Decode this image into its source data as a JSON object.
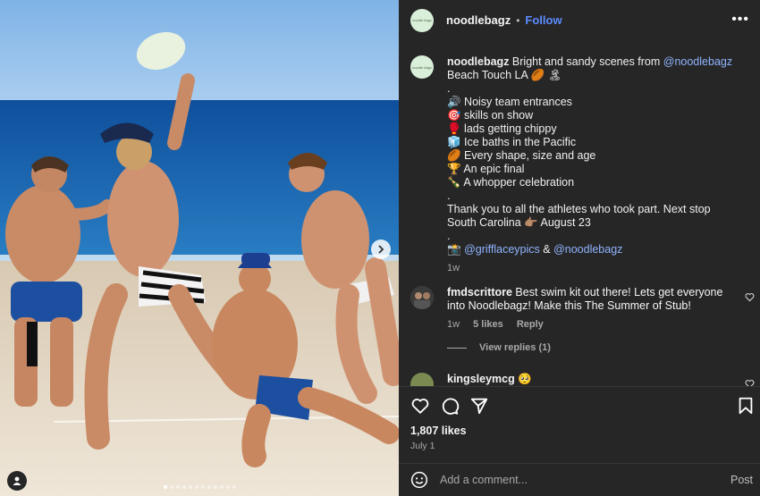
{
  "header": {
    "username": "noodlebagz",
    "avatar_text": "noodle bagz",
    "separator": "•",
    "follow_label": "Follow",
    "more_label": "•••"
  },
  "caption": {
    "username": "noodlebagz",
    "text_start": " Bright and sandy scenes from ",
    "mention": "@noodlebagz",
    "line2": "Beach Touch LA 🏉 🏝",
    "dot1": ".",
    "list": [
      "🔊 Noisy team entrances",
      "🎯 skills on show",
      "🥊 lads getting chippy",
      "🧊 Ice baths in the Pacific",
      "🏉 Every shape, size and age",
      "🏆 An epic final",
      "🍾 A whopper celebration"
    ],
    "dot2": ".",
    "thanks": "Thank you to all the athletes who took part. Next stop South Carolina 👉🏽 August 23",
    "dot3": ".",
    "credit_icon": "📸",
    "credit_mention1": "@grifflaceypics",
    "credit_amp": " & ",
    "credit_mention2": "@noodlebagz",
    "time": "1w"
  },
  "comments": [
    {
      "username": "fmdscrittore",
      "text": " Best swim kit out there! Lets get everyone into Noodlebagz! Make this The Summer of Stub!",
      "time": "1w",
      "likes": "5 likes",
      "reply": "Reply"
    },
    {
      "username": "kingsleymcg",
      "text": " 🥺"
    }
  ],
  "view_replies": "View replies (1)",
  "likes_count": "1,807 likes",
  "post_date": "July 1",
  "add_comment": {
    "placeholder": "Add a comment...",
    "post_label": "Post"
  },
  "icons": {
    "heart": "heart-icon",
    "comment": "comment-icon",
    "share": "share-icon",
    "bookmark": "bookmark-icon",
    "emoji": "emoji-icon",
    "next": "chevron-right-icon",
    "tag": "user-tag-icon"
  },
  "carousel": {
    "count": 12,
    "active": 0
  },
  "colors": {
    "panel": "#262626",
    "follow": "#5b8cff",
    "link": "#8fb4ff",
    "muted": "#a8a8a8"
  }
}
